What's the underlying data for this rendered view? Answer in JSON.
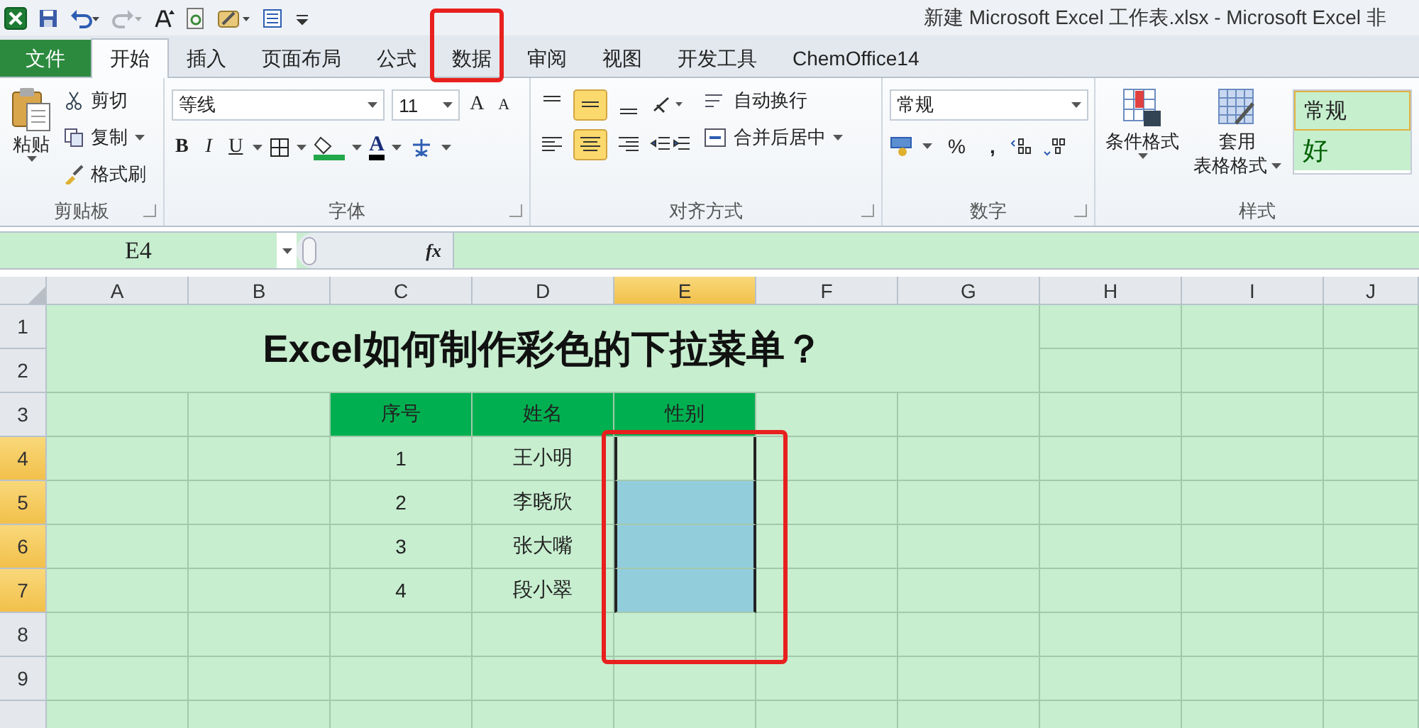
{
  "title": "新建 Microsoft Excel 工作表.xlsx - Microsoft Excel 非",
  "tabs": [
    {
      "label": "文件",
      "kind": "file",
      "selected": false
    },
    {
      "label": "开始",
      "kind": "tab",
      "selected": true
    },
    {
      "label": "插入",
      "kind": "tab",
      "selected": false
    },
    {
      "label": "页面布局",
      "kind": "tab",
      "selected": false
    },
    {
      "label": "公式",
      "kind": "tab",
      "selected": false
    },
    {
      "label": "数据",
      "kind": "tab",
      "selected": false
    },
    {
      "label": "审阅",
      "kind": "tab",
      "selected": false
    },
    {
      "label": "视图",
      "kind": "tab",
      "selected": false
    },
    {
      "label": "开发工具",
      "kind": "tab",
      "selected": false
    },
    {
      "label": "ChemOffice14",
      "kind": "tab",
      "selected": false
    }
  ],
  "clipboard": {
    "paste": "粘贴",
    "cut": "剪切",
    "copy": "复制",
    "format_painter": "格式刷",
    "label": "剪贴板"
  },
  "font": {
    "name": "等线",
    "size": "11",
    "grow": "A",
    "shrink": "A",
    "bold": "B",
    "italic": "I",
    "underline": "U",
    "font_color": "A",
    "label": "字体"
  },
  "alignment": {
    "wrap": "自动换行",
    "merge": "合并后居中",
    "label": "对齐方式"
  },
  "number": {
    "format": "常规",
    "percent": "%",
    "comma": ",",
    "label": "数字"
  },
  "styles": {
    "conditional": "条件格式",
    "table_line_1": "套用",
    "table_line_2": "表格格式",
    "normal": "常规",
    "good": "好",
    "label": "样式"
  },
  "name_box": "E4",
  "function_button": "fx",
  "columns": [
    {
      "label": "A",
      "selected": false
    },
    {
      "label": "B",
      "selected": false
    },
    {
      "label": "C",
      "selected": false
    },
    {
      "label": "D",
      "selected": false
    },
    {
      "label": "E",
      "selected": true
    },
    {
      "label": "F",
      "selected": false
    },
    {
      "label": "G",
      "selected": false
    },
    {
      "label": "H",
      "selected": false
    },
    {
      "label": "I",
      "selected": false
    },
    {
      "label": "J",
      "selected": false
    }
  ],
  "rows": [
    {
      "label": "1",
      "selected": false
    },
    {
      "label": "2",
      "selected": false
    },
    {
      "label": "3",
      "selected": false
    },
    {
      "label": "4",
      "selected": true
    },
    {
      "label": "5",
      "selected": true
    },
    {
      "label": "6",
      "selected": true
    },
    {
      "label": "7",
      "selected": true
    },
    {
      "label": "8",
      "selected": false
    },
    {
      "label": "9",
      "selected": false
    }
  ],
  "sheet_title": "Excel如何制作彩色的下拉菜单？",
  "table": {
    "headers": [
      "序号",
      "姓名",
      "性别"
    ],
    "rows": [
      {
        "no": "1",
        "name": "王小明"
      },
      {
        "no": "2",
        "name": "李晓欣",
        "color": "#92cddc"
      },
      {
        "no": "3",
        "name": "张大嘴",
        "color": "#92cddc"
      },
      {
        "no": "4",
        "name": "段小翠",
        "color": "#92cddc"
      }
    ]
  }
}
